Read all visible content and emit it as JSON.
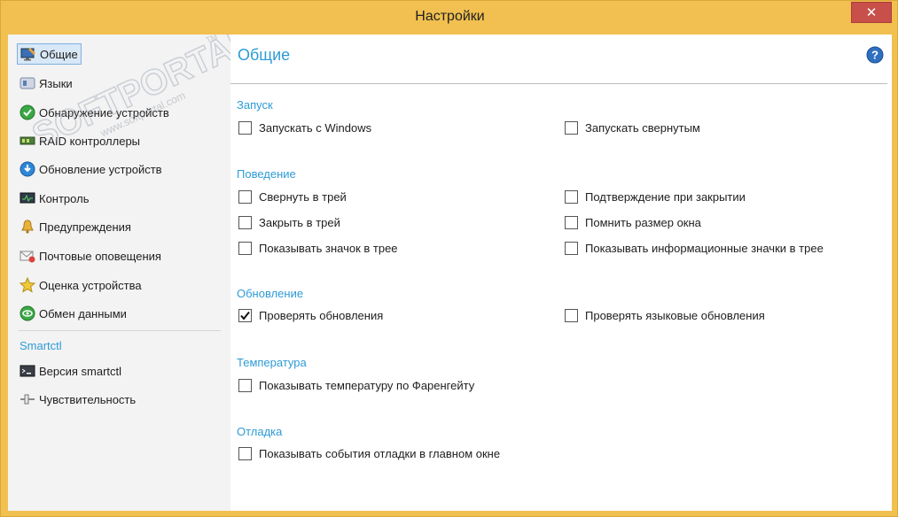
{
  "window": {
    "title": "Настройки",
    "close_glyph": "✕"
  },
  "watermark": {
    "text": "SOFTPORTAL",
    "url": "www.softportal.com",
    "tm": "TM"
  },
  "sidebar": {
    "items": [
      {
        "label": "Общие",
        "icon": "monitor-settings-icon"
      },
      {
        "label": "Языки",
        "icon": "language-icon"
      },
      {
        "label": "Обнаружение устройств",
        "icon": "device-detect-icon"
      },
      {
        "label": "RAID контроллеры",
        "icon": "raid-icon"
      },
      {
        "label": "Обновление устройств",
        "icon": "device-update-icon"
      },
      {
        "label": "Контроль",
        "icon": "monitor-icon"
      },
      {
        "label": "Предупреждения",
        "icon": "bell-icon"
      },
      {
        "label": "Почтовые оповещения",
        "icon": "mail-icon"
      },
      {
        "label": "Оценка устройства",
        "icon": "star-icon"
      },
      {
        "label": "Обмен данными",
        "icon": "data-exchange-icon"
      }
    ],
    "group_label": "Smartctl",
    "group_items": [
      {
        "label": "Версия smartctl",
        "icon": "terminal-icon"
      },
      {
        "label": "Чувствительность",
        "icon": "slider-icon"
      }
    ]
  },
  "content": {
    "title": "Общие",
    "help_glyph": "?",
    "sections": {
      "startup": {
        "title": "Запуск",
        "options": [
          {
            "label": "Запускать с Windows",
            "checked": false
          },
          {
            "label": "Запускать свернутым",
            "checked": false
          }
        ]
      },
      "behavior": {
        "title": "Поведение",
        "options": [
          {
            "label": "Свернуть в трей",
            "checked": false
          },
          {
            "label": "Подтверждение при закрытии",
            "checked": false
          },
          {
            "label": "Закрыть в трей",
            "checked": false
          },
          {
            "label": "Помнить размер окна",
            "checked": false
          },
          {
            "label": "Показывать значок в трее",
            "checked": false
          },
          {
            "label": "Показывать информационные значки в трее",
            "checked": false
          }
        ]
      },
      "update": {
        "title": "Обновление",
        "options": [
          {
            "label": "Проверять обновления",
            "checked": true
          },
          {
            "label": "Проверять языковые обновления",
            "checked": false
          }
        ]
      },
      "temperature": {
        "title": "Температура",
        "options": [
          {
            "label": "Показывать температуру по Фаренгейту",
            "checked": false
          }
        ]
      },
      "debug": {
        "title": "Отладка",
        "options": [
          {
            "label": "Показывать события отладки в главном окне",
            "checked": false
          }
        ]
      }
    }
  },
  "colors": {
    "accent": "#2e9bd6",
    "frame": "#f1c050",
    "close": "#c7504a"
  }
}
